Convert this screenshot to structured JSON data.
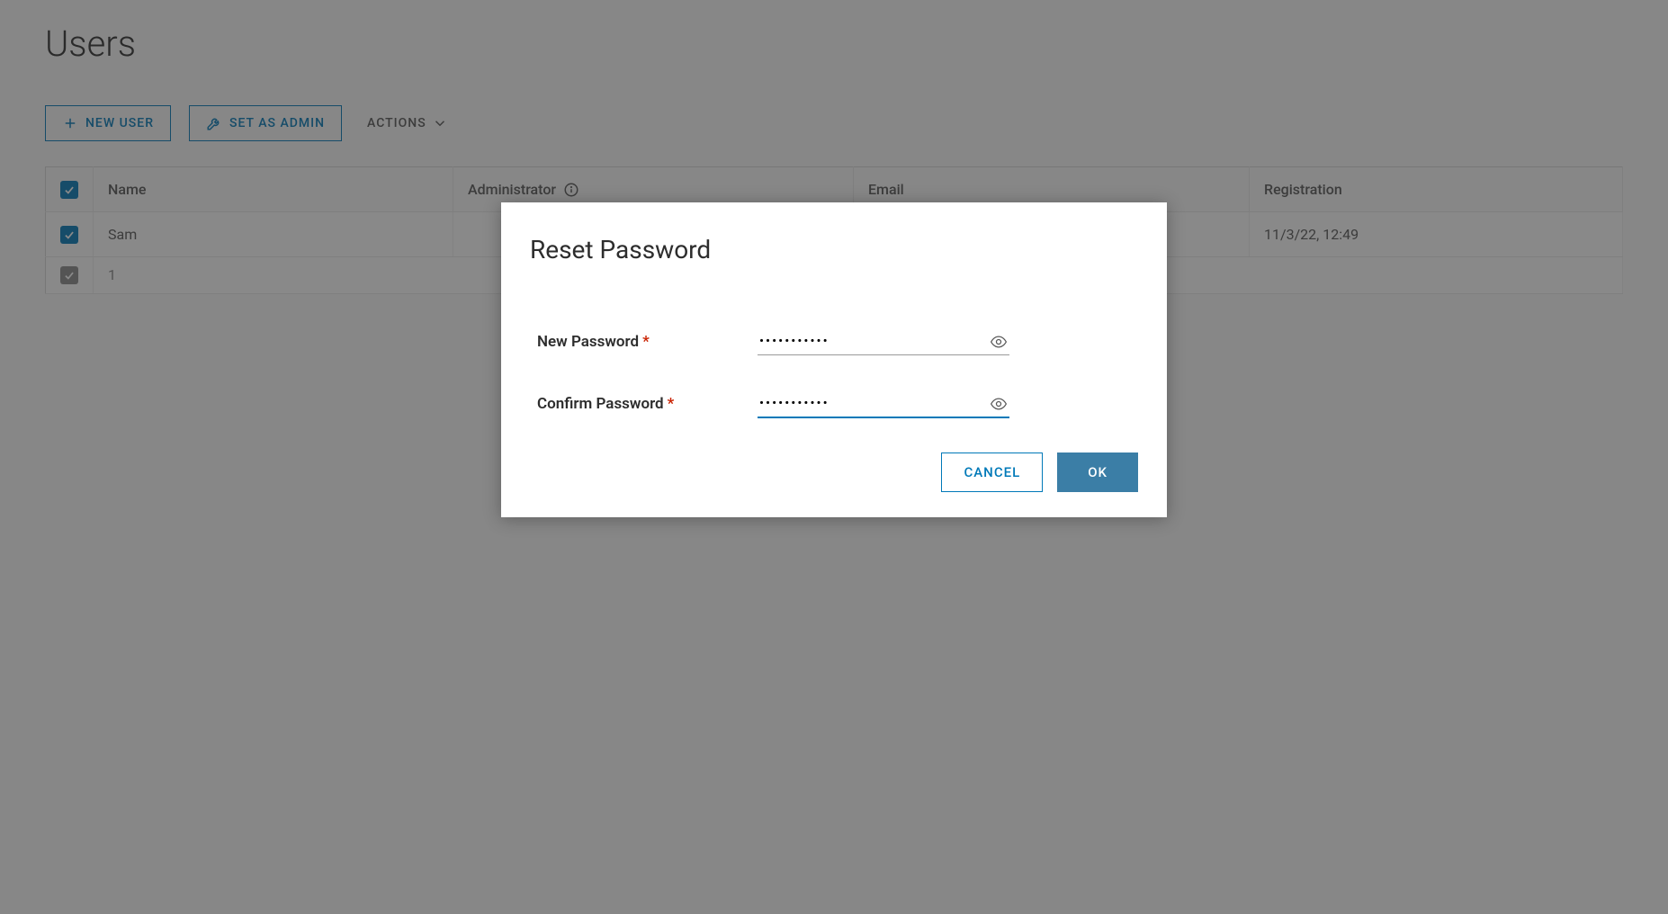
{
  "page": {
    "title": "Users"
  },
  "toolbar": {
    "new_user": "NEW USER",
    "set_as_admin": "SET AS ADMIN",
    "actions": "ACTIONS"
  },
  "table": {
    "headers": {
      "name": "Name",
      "admin": "Administrator",
      "email": "Email",
      "registration": "Registration"
    },
    "rows": [
      {
        "name": "Sam",
        "admin": "",
        "email": "",
        "registration": "11/3/22, 12:49"
      }
    ],
    "footer_count": "1"
  },
  "modal": {
    "title": "Reset Password",
    "new_password_label": "New Password",
    "confirm_password_label": "Confirm Password",
    "new_password_value": "•••••••••••",
    "confirm_password_value": "•••••••••••",
    "cancel": "CANCEL",
    "ok": "OK"
  }
}
